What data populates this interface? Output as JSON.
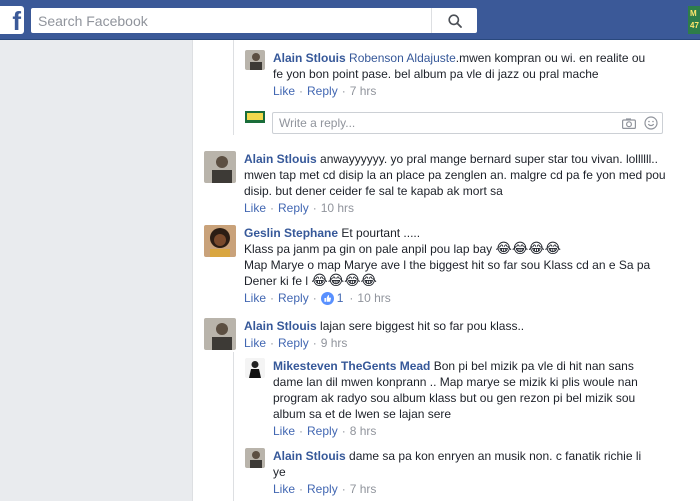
{
  "topbar": {
    "logo": "f",
    "search_placeholder": "Search Facebook",
    "corner_badge": "M 47"
  },
  "comments": [
    {
      "author": "Alain Stlouis",
      "mention": "Robenson Aldajuste",
      "text": ".mwen kompran ou wi. en realite ou fe yon bon point pase. bel album pa vle di jazz ou pral mache",
      "like": "Like",
      "reply": "Reply",
      "time": "7 hrs"
    },
    {
      "author": "Alain Stlouis",
      "text": "anwayyyyyy. yo pral mange bernard super star tou vivan. lollllll.. mwen tap met cd disip la an place pa zenglen an. malgre cd pa fe yon med pou disip. but dener ceider fe sal te kapab ak mort sa",
      "like": "Like",
      "reply": "Reply",
      "time": "10 hrs"
    },
    {
      "author": "Geslin Stephane",
      "text_line1": "Et pourtant .....",
      "text_line2": "Klass pa janm pa gin on pale anpil pou lap bay",
      "emojis_line2": "😂😂😂😂",
      "text_line3": "Map Marye o map Marye ave l the biggest hit so far sou Klass cd an e Sa pa Dener ki fe l",
      "emojis_line3": "😂😂😂😂",
      "like": "Like",
      "reply": "Reply",
      "reaction_count": "1",
      "time": "10 hrs"
    },
    {
      "author": "Alain Stlouis",
      "text": "lajan sere biggest hit so far pou klass..",
      "like": "Like",
      "reply": "Reply",
      "time": "9 hrs"
    },
    {
      "author": "Mikesteven TheGents Mead",
      "text": "Bon pi bel mizik pa vle di hit nan sans dame lan dil mwen konprann .. Map marye se mizik ki plis woule nan program ak radyo sou album klass but ou gen rezon pi bel mizik sou album sa et de lwen se lajan sere",
      "like": "Like",
      "reply": "Reply",
      "time": "8 hrs"
    },
    {
      "author": "Alain Stlouis",
      "text": "dame sa pa kon enryen an musik non. c fanatik richie li ye",
      "like": "Like",
      "reply": "Reply",
      "time": "7 hrs"
    }
  ],
  "reply_box": {
    "placeholder": "Write a reply...",
    "avatar_text": "MIC"
  },
  "separator": "·",
  "colors": {
    "header": "#3b5998",
    "link": "#365899",
    "action": "#4267b2",
    "meta": "#90949c"
  }
}
